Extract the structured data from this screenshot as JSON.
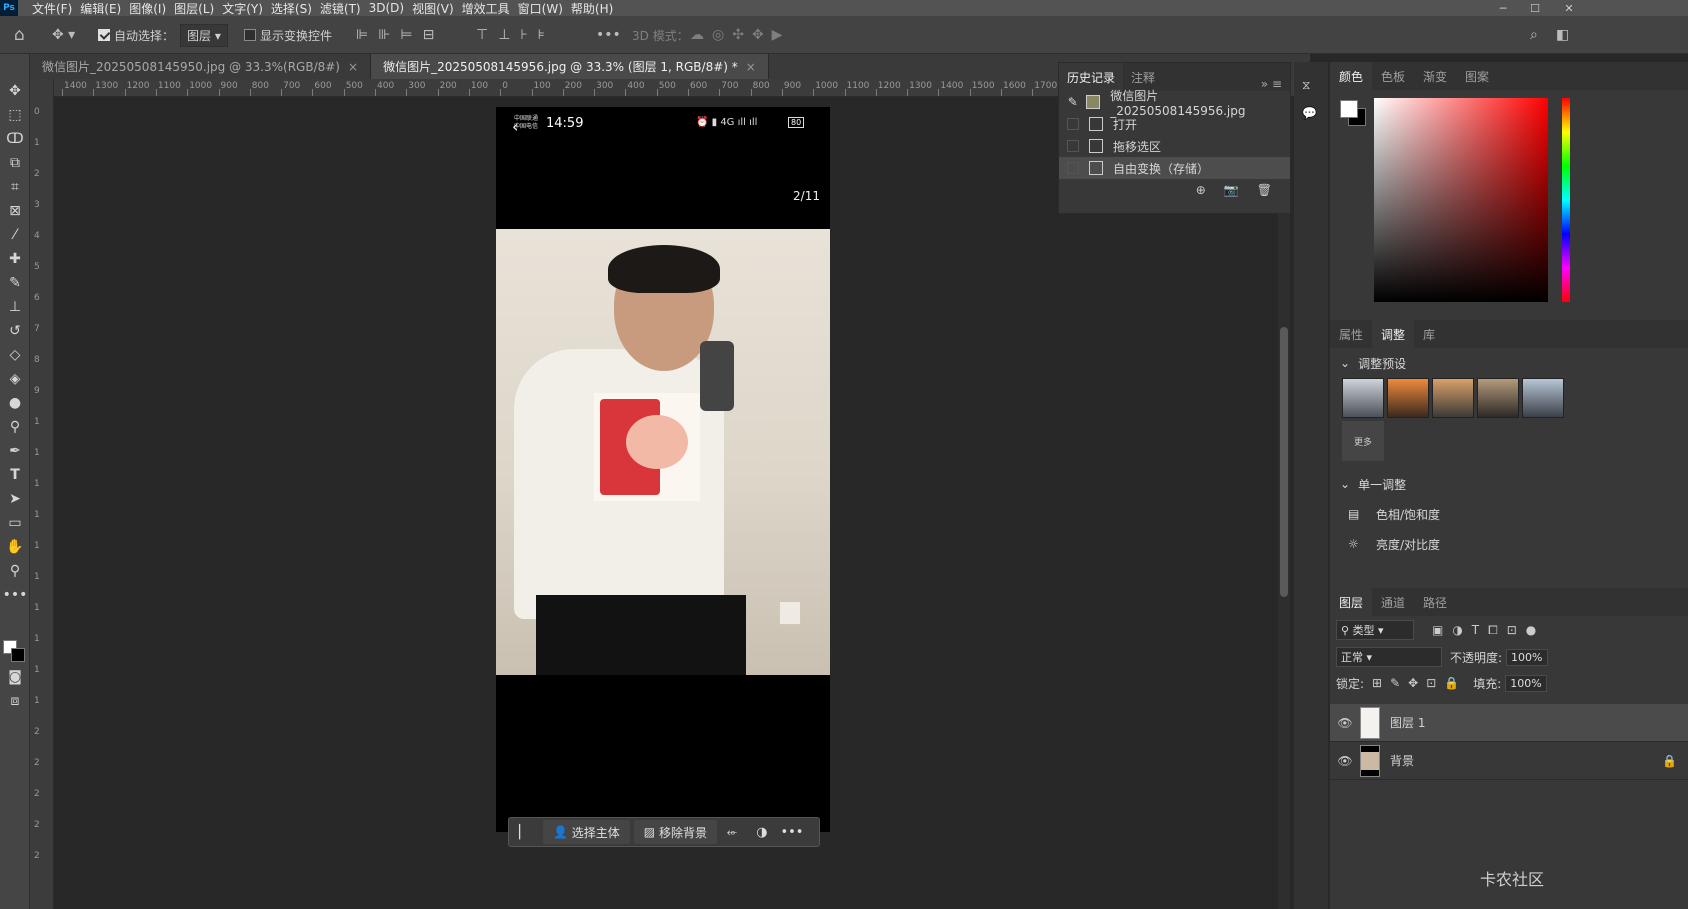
{
  "menu": {
    "items": [
      "文件(F)",
      "编辑(E)",
      "图像(I)",
      "图层(L)",
      "文字(Y)",
      "选择(S)",
      "滤镜(T)",
      "3D(D)",
      "视图(V)",
      "增效工具",
      "窗口(W)",
      "帮助(H)"
    ],
    "logo": "Ps"
  },
  "options": {
    "auto_select_label": "自动选择：",
    "auto_select_value": "图层",
    "show_transform_label": "显示变换控件",
    "mode_3d_label": "3D 模式："
  },
  "tabs": [
    {
      "label": "微信图片_20250508145950.jpg @ 33.3%(RGB/8#)",
      "close": "×"
    },
    {
      "label": "微信图片_20250508145956.jpg @ 33.3% (图层 1, RGB/8#) *",
      "close": "×"
    }
  ],
  "ruler": {
    "h": [
      "1400",
      "1300",
      "1200",
      "1100",
      "1000",
      "900",
      "800",
      "700",
      "600",
      "500",
      "400",
      "300",
      "200",
      "100",
      "0",
      "100",
      "200",
      "300",
      "400",
      "500",
      "600",
      "700",
      "800",
      "900",
      "1000",
      "1100",
      "1200",
      "1300",
      "1400",
      "1500",
      "1600",
      "1700"
    ],
    "v": [
      "0",
      "1",
      "2",
      "3",
      "4",
      "5",
      "6",
      "7",
      "8",
      "9",
      "1",
      "1",
      "1",
      "1",
      "1",
      "1",
      "1",
      "1",
      "1",
      "1",
      "2",
      "2",
      "2",
      "2",
      "2"
    ]
  },
  "phone": {
    "time": "14:59",
    "carrier1": "中国联通",
    "carrier2": "中国电信",
    "battery": "80",
    "page": "2/11",
    "signal": "4G"
  },
  "context_bar": {
    "select_subject": "选择主体",
    "remove_bg": "移除背景"
  },
  "history": {
    "tab_history": "历史记录",
    "tab_notes": "注释",
    "snapshot": "微信图片_20250508145956.jpg",
    "items": [
      "打开",
      "拖移选区",
      "自由变换（存储）"
    ]
  },
  "color_panel": {
    "tabs": [
      "颜色",
      "色板",
      "渐变",
      "图案"
    ]
  },
  "adjust_panel": {
    "tabs": [
      "属性",
      "调整",
      "库"
    ],
    "presets_title": "调整预设",
    "more": "更多",
    "single_title": "单一调整",
    "items": [
      "色相/饱和度",
      "亮度/对比度"
    ]
  },
  "layers_panel": {
    "tabs": [
      "图层",
      "通道",
      "路径"
    ],
    "filter": "类型",
    "blend": "正常",
    "opacity_label": "不透明度:",
    "opacity": "100%",
    "lock_label": "锁定:",
    "fill_label": "填充:",
    "fill": "100%",
    "layers": [
      "图层 1",
      "背景"
    ]
  },
  "watermark": "卡农社区"
}
